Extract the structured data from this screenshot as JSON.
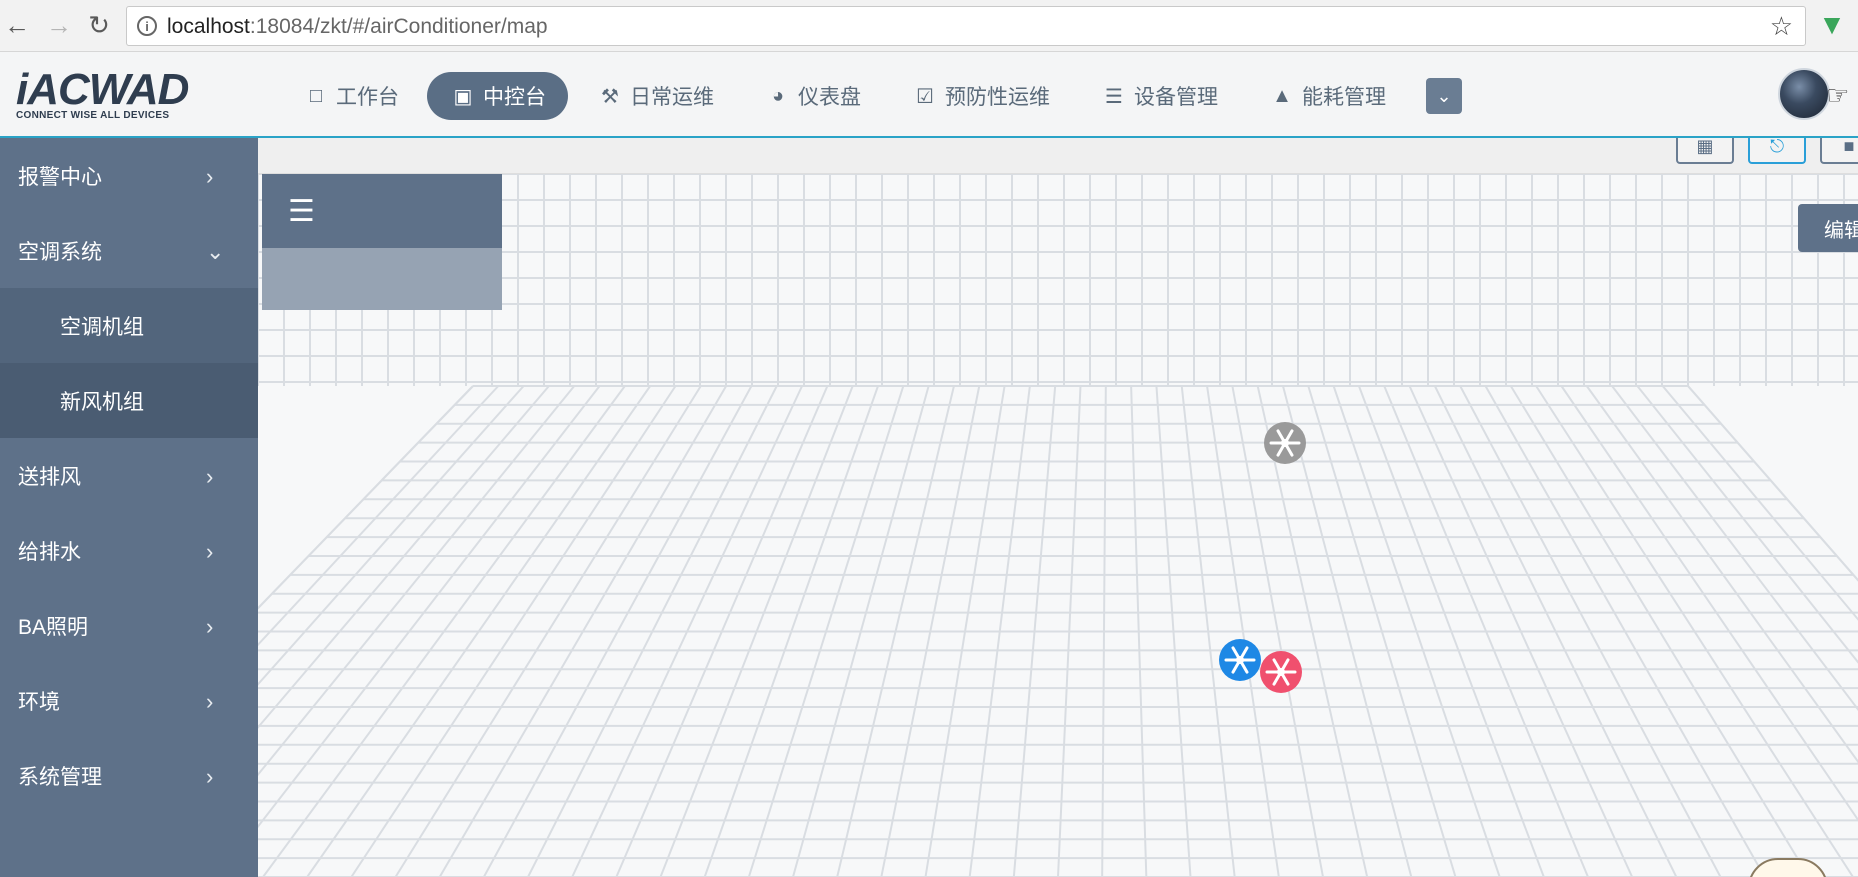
{
  "browser": {
    "url_host": "localhost",
    "url_path": ":18084/zkt/#/airConditioner/map"
  },
  "app": {
    "logo_text": "iACWAD",
    "logo_tagline": "CONNECT WISE ALL DEVICES",
    "nav": [
      {
        "label": "工作台",
        "icon": "laptop-icon"
      },
      {
        "label": "中控台",
        "icon": "monitor-icon",
        "active": true
      },
      {
        "label": "日常运维",
        "icon": "wrench-icon"
      },
      {
        "label": "仪表盘",
        "icon": "dashboard-icon"
      },
      {
        "label": "预防性运维",
        "icon": "calendar-check-icon"
      },
      {
        "label": "设备管理",
        "icon": "server-icon"
      },
      {
        "label": "能耗管理",
        "icon": "area-chart-icon"
      }
    ]
  },
  "sidebar": {
    "items": [
      {
        "label": "报警中心"
      },
      {
        "label": "空调系统"
      },
      {
        "label": "空调机组"
      },
      {
        "label": "新风机组"
      },
      {
        "label": "送排风"
      },
      {
        "label": "给排水"
      },
      {
        "label": "BA照明"
      },
      {
        "label": "环境"
      },
      {
        "label": "系统管理"
      }
    ]
  },
  "main": {
    "edit_label": "编辑",
    "markers": [
      {
        "name": "snowflake-marker-gray",
        "color": "#9a9a9a"
      },
      {
        "name": "snowflake-marker-blue",
        "color": "#1e88e5"
      },
      {
        "name": "snowflake-marker-red",
        "color": "#f0506e"
      }
    ]
  }
}
